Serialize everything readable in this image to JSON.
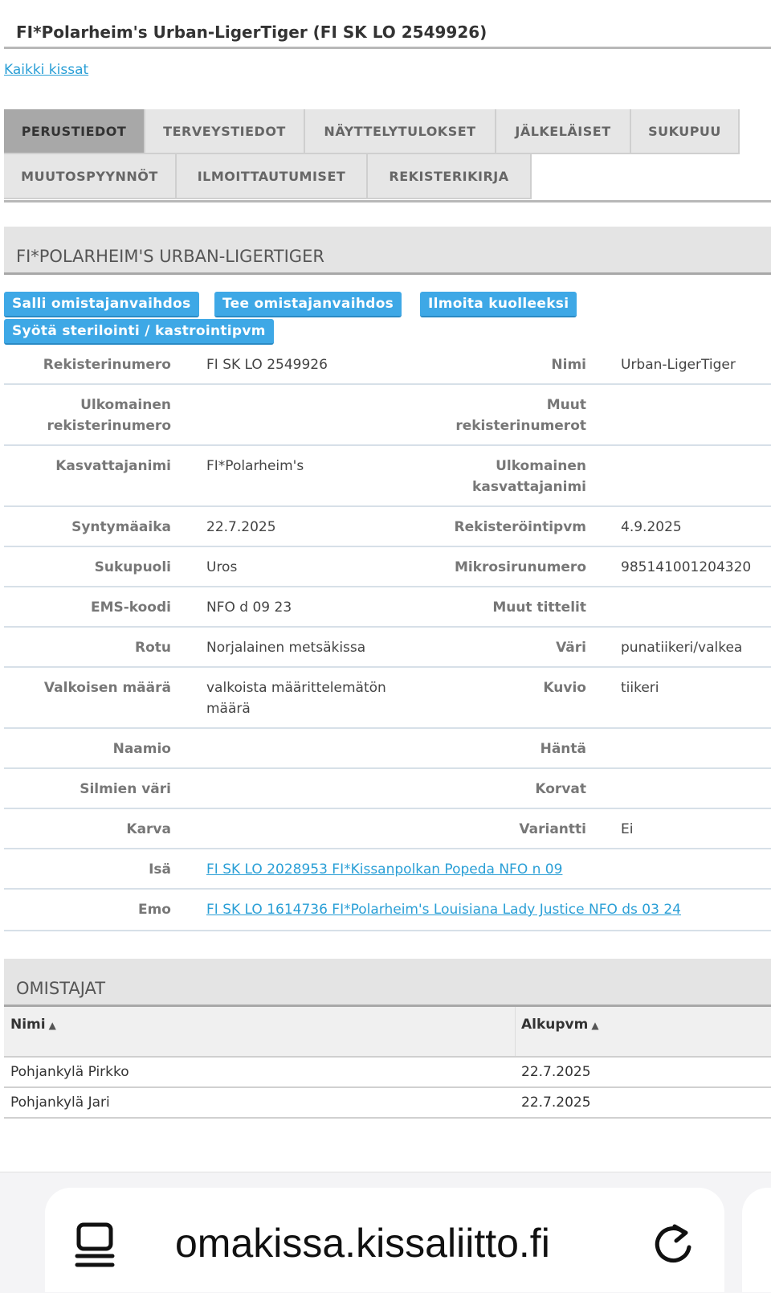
{
  "page": {
    "title": "FI*Polarheim's Urban-LigerTiger (FI SK LO 2549926)",
    "all_cats_link": "Kaikki kissat"
  },
  "tabs": [
    {
      "label": "PERUSTIEDOT",
      "active": true
    },
    {
      "label": "TERVEYSTIEDOT"
    },
    {
      "label": "NÄYTTELYTULOKSET"
    },
    {
      "label": "JÄLKELÄISET"
    },
    {
      "label": "SUKUPUU"
    },
    {
      "label": "MUUTOSPYYNNÖT"
    },
    {
      "label": "ILMOITTAUTUMISET"
    },
    {
      "label": "REKISTERIKIRJA"
    }
  ],
  "cat_section": {
    "heading": "FI*POLARHEIM'S URBAN-LIGERTIGER",
    "buttons": {
      "allow_owner_change": "Salli omistajanvaihdos",
      "make_owner_change": "Tee omistajanvaihdos",
      "report_dead": "Ilmoita kuolleeksi",
      "enter_sterilization": "Syötä sterilointi / kastrointipvm"
    }
  },
  "details": [
    {
      "label1": "Rekisterinumero",
      "value1": "FI SK LO 2549926",
      "label2": "Nimi",
      "value2": "Urban-LigerTiger"
    },
    {
      "label1": "Ulkomainen rekisterinumero",
      "value1": "",
      "label2": "Muut rekisterinumerot",
      "value2": ""
    },
    {
      "label1": "Kasvattajanimi",
      "value1": "FI*Polarheim's",
      "label2": "Ulkomainen kasvattajanimi",
      "value2": ""
    },
    {
      "label1": "Syntymäaika",
      "value1": "22.7.2025",
      "label2": "Rekisteröintipvm",
      "value2": "4.9.2025"
    },
    {
      "label1": "Sukupuoli",
      "value1": "Uros",
      "label2": "Mikrosirunumero",
      "value2": "985141001204320"
    },
    {
      "label1": "EMS-koodi",
      "value1": "NFO d 09 23",
      "label2": "Muut tittelit",
      "value2": ""
    },
    {
      "label1": "Rotu",
      "value1": "Norjalainen metsäkissa",
      "label2": "Väri",
      "value2": "punatiikeri/valkea"
    },
    {
      "label1": "Valkoisen määrä",
      "value1": "valkoista määrittelemätön määrä",
      "label2": "Kuvio",
      "value2": "tiikeri"
    },
    {
      "label1": "Naamio",
      "value1": "",
      "label2": "Häntä",
      "value2": ""
    },
    {
      "label1": "Silmien väri",
      "value1": "",
      "label2": "Korvat",
      "value2": ""
    },
    {
      "label1": "Karva",
      "value1": "",
      "label2": "Variantti",
      "value2": "Ei"
    },
    {
      "label1": "Isä",
      "value1": "FI SK LO 2028953 FI*Kissanpolkan Popeda NFO n 09"
    },
    {
      "label1": "Emo",
      "value1": "FI SK LO 1614736 FI*Polarheim's Louisiana Lady Justice NFO ds 03 24"
    }
  ],
  "owners": {
    "heading": "OMISTAJAT",
    "columns": [
      "Nimi",
      "Alkupvm"
    ],
    "rows": [
      {
        "name": "Pohjankylä Pirkko",
        "start": "22.7.2025"
      },
      {
        "name": "Pohjankylä Jari",
        "start": "22.7.2025"
      }
    ]
  },
  "browser": {
    "url": "omakissa.kissaliitto.fi",
    "reader_icon": "reader-mode-icon",
    "reload_icon": "reload-icon"
  },
  "colors": {
    "accent": "#3ea8e6",
    "link": "#2a9fd6",
    "active_tab": "#a8a8a8",
    "tab_bg": "#e6e6e6"
  }
}
